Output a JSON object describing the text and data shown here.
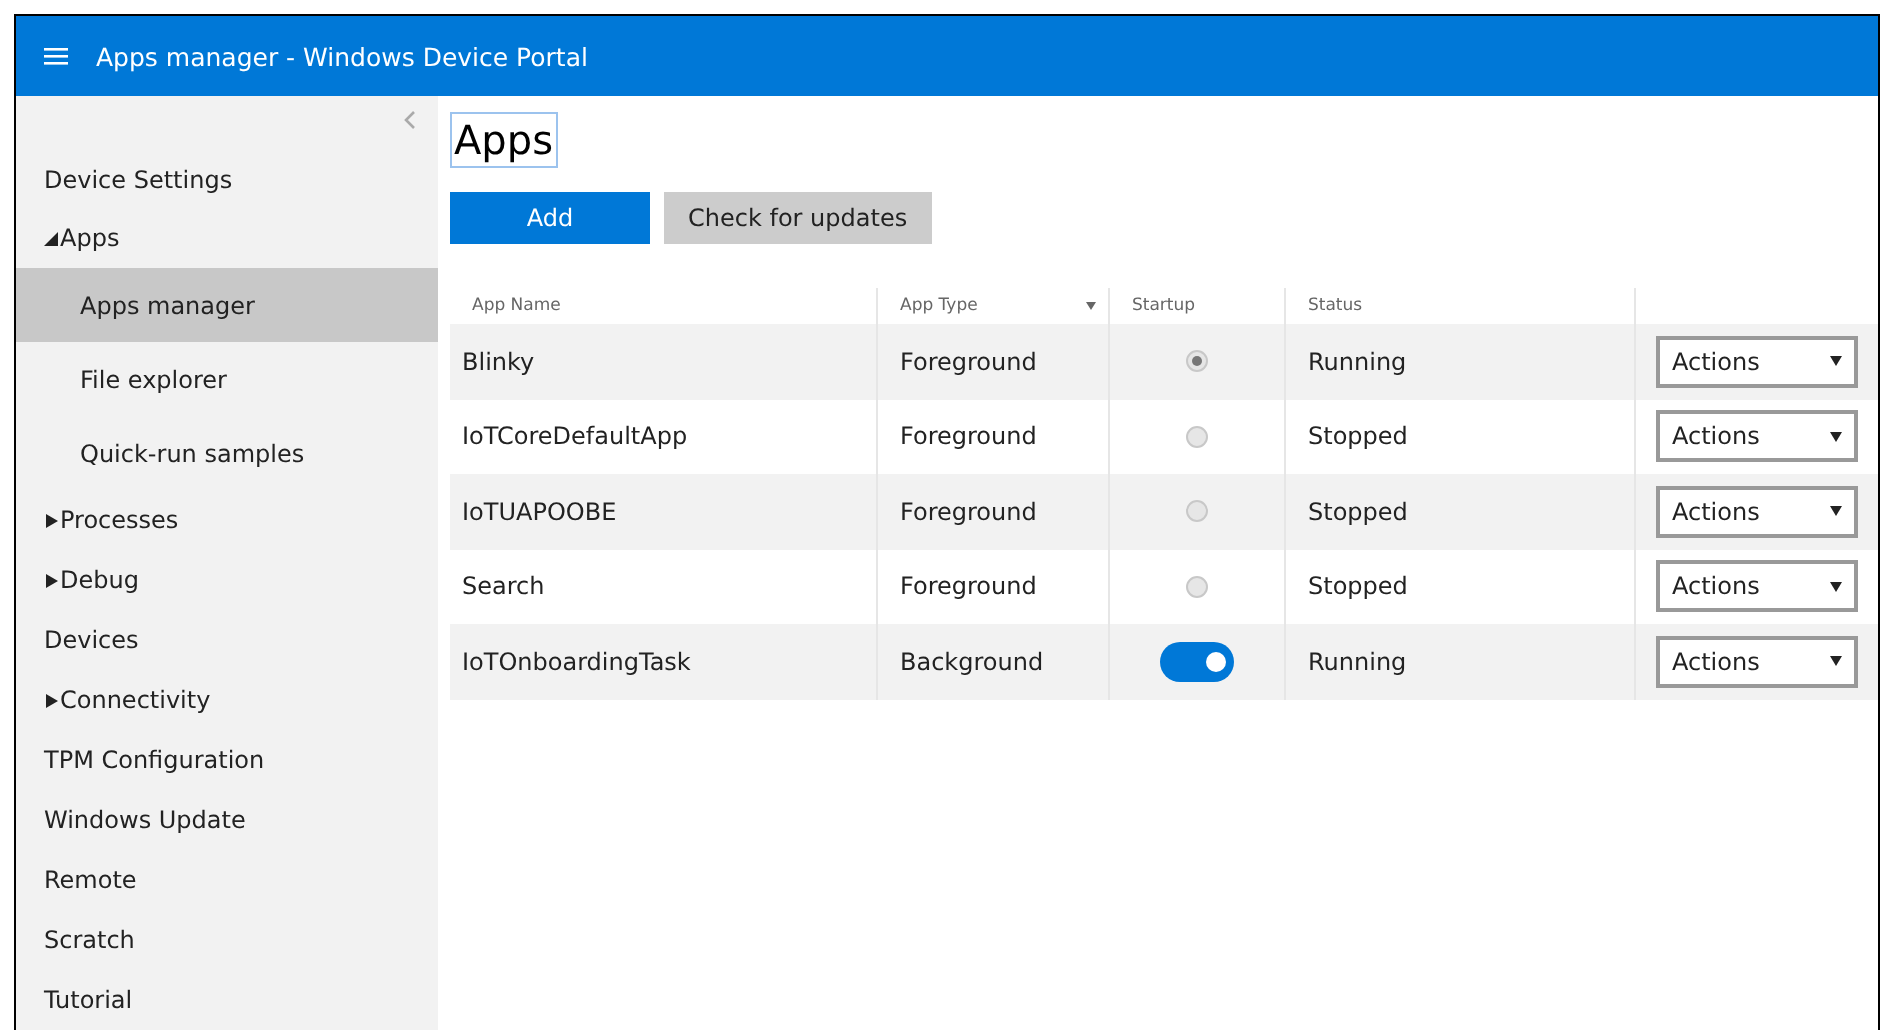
{
  "header": {
    "title": "Apps manager - Windows Device Portal"
  },
  "sidebar": {
    "items": [
      {
        "label": "Device Settings",
        "kind": "link",
        "selected": false
      },
      {
        "label": "Apps",
        "kind": "group",
        "expanded": true,
        "selected": false,
        "children": [
          {
            "label": "Apps manager",
            "selected": true
          },
          {
            "label": "File explorer",
            "selected": false
          },
          {
            "label": "Quick-run samples",
            "selected": false
          }
        ]
      },
      {
        "label": "Processes",
        "kind": "group",
        "expanded": false,
        "selected": false
      },
      {
        "label": "Debug",
        "kind": "group",
        "expanded": false,
        "selected": false
      },
      {
        "label": "Devices",
        "kind": "link",
        "selected": false
      },
      {
        "label": "Connectivity",
        "kind": "group",
        "expanded": false,
        "selected": false
      },
      {
        "label": "TPM Configuration",
        "kind": "link",
        "selected": false
      },
      {
        "label": "Windows Update",
        "kind": "link",
        "selected": false
      },
      {
        "label": "Remote",
        "kind": "link",
        "selected": false
      },
      {
        "label": "Scratch",
        "kind": "link",
        "selected": false
      },
      {
        "label": "Tutorial",
        "kind": "link",
        "selected": false
      }
    ]
  },
  "page": {
    "title": "Apps",
    "buttons": [
      {
        "label": "Add",
        "kind": "primary"
      },
      {
        "label": "Check for updates",
        "kind": "secondary"
      }
    ]
  },
  "table": {
    "columns": [
      {
        "label": "App Name",
        "sorted": false
      },
      {
        "label": "App Type",
        "sorted": true
      },
      {
        "label": "Startup",
        "sorted": false
      },
      {
        "label": "Status",
        "sorted": false
      }
    ],
    "rows": [
      {
        "name": "Blinky",
        "type": "Foreground",
        "startup": {
          "kind": "radio",
          "selected": true
        },
        "status": "Running",
        "action": "Actions"
      },
      {
        "name": "IoTCoreDefaultApp",
        "type": "Foreground",
        "startup": {
          "kind": "radio",
          "selected": false
        },
        "status": "Stopped",
        "action": "Actions"
      },
      {
        "name": "IoTUAPOOBE",
        "type": "Foreground",
        "startup": {
          "kind": "radio",
          "selected": false
        },
        "status": "Stopped",
        "action": "Actions"
      },
      {
        "name": "Search",
        "type": "Foreground",
        "startup": {
          "kind": "radio",
          "selected": false
        },
        "status": "Stopped",
        "action": "Actions"
      },
      {
        "name": "IoTOnboardingTask",
        "type": "Background",
        "startup": {
          "kind": "toggle",
          "on": true
        },
        "status": "Running",
        "action": "Actions"
      }
    ]
  }
}
